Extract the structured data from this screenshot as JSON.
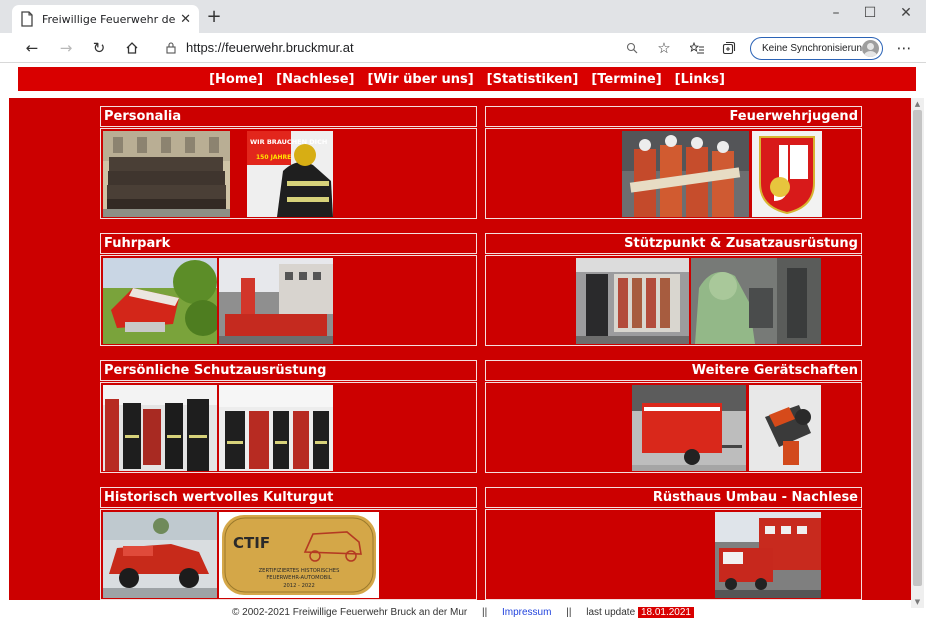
{
  "browser": {
    "tab_title": "Freiwillige Feuerwehr der Stadt B",
    "url": "https://feuerwehr.bruckmur.at",
    "sync_label": "Keine Synchronisierung"
  },
  "nav": [
    {
      "label": "[Home]"
    },
    {
      "label": "[Nachlese]"
    },
    {
      "label": "[Wir über uns]"
    },
    {
      "label": "[Statistiken]"
    },
    {
      "label": "[Termine]"
    },
    {
      "label": "[Links]"
    }
  ],
  "panels": [
    {
      "title": "Personalia"
    },
    {
      "title": "Feuerwehrjugend"
    },
    {
      "title": "Fuhrpark"
    },
    {
      "title": "Stützpunkt & Zusatzausrüstung"
    },
    {
      "title": "Persönliche Schutzausrüstung"
    },
    {
      "title": "Weitere Gerätschaften"
    },
    {
      "title": "Historisch wertvolles Kulturgut"
    },
    {
      "title": "Rüsthaus Umbau - Nachlese"
    }
  ],
  "poster": {
    "text_line1": "WIR BRAUCHEN DICH",
    "text_line2": "150 JAHRE"
  },
  "ctif": {
    "brand": "CTIF",
    "line1": "ZERTIFIZIERTES HISTORISCHES",
    "line2": "FEUERWEHR-AUTOMOBIL",
    "years": "2012 - 2022"
  },
  "footer": {
    "copyright": "© 2002-2021 Freiwillige Feuerwehr Bruck an der Mur",
    "separator": "||",
    "impressum": "Impressum",
    "last_update_label": "last update",
    "last_update_date": "18.01.2021"
  },
  "colors": {
    "brand_red": "#cc0000",
    "nav_red": "#d90000"
  }
}
